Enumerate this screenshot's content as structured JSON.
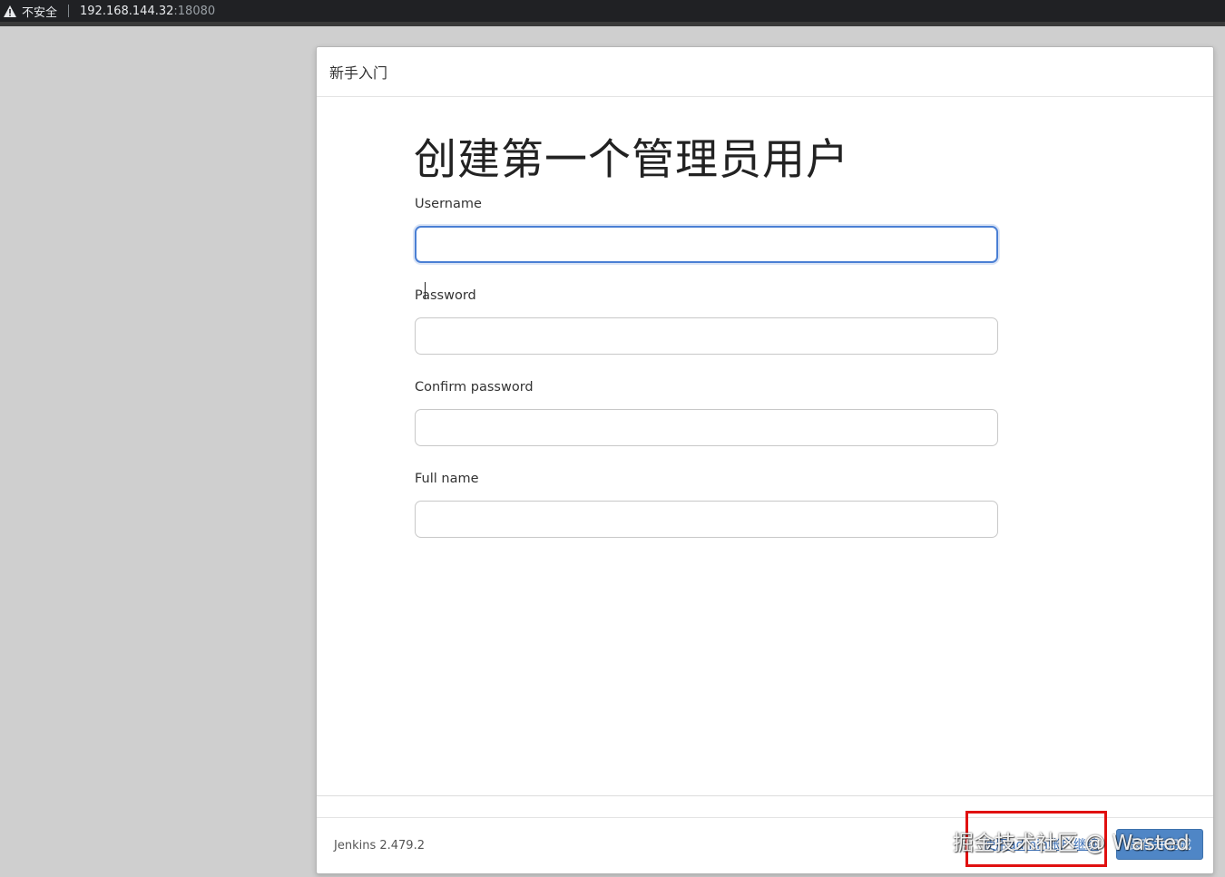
{
  "browser": {
    "insecure_label": "不安全",
    "url_host": "192.168.144.32",
    "url_port": ":18080"
  },
  "dialog": {
    "header_title": "新手入门",
    "page_title": "创建第一个管理员用户",
    "fields": [
      {
        "label": "Username",
        "value": ""
      },
      {
        "label": "Password",
        "value": ""
      },
      {
        "label": "Confirm password",
        "value": ""
      },
      {
        "label": "Full name",
        "value": ""
      }
    ],
    "version": "Jenkins 2.479.2",
    "skip_label": "使用admin账户继续",
    "save_label": "保存并完成"
  },
  "watermark": "掘金技术社区 @ Wasted",
  "colors": {
    "focus_border": "#4a7fd4",
    "primary_button": "#4f86c6",
    "highlight_box": "#e01010"
  }
}
